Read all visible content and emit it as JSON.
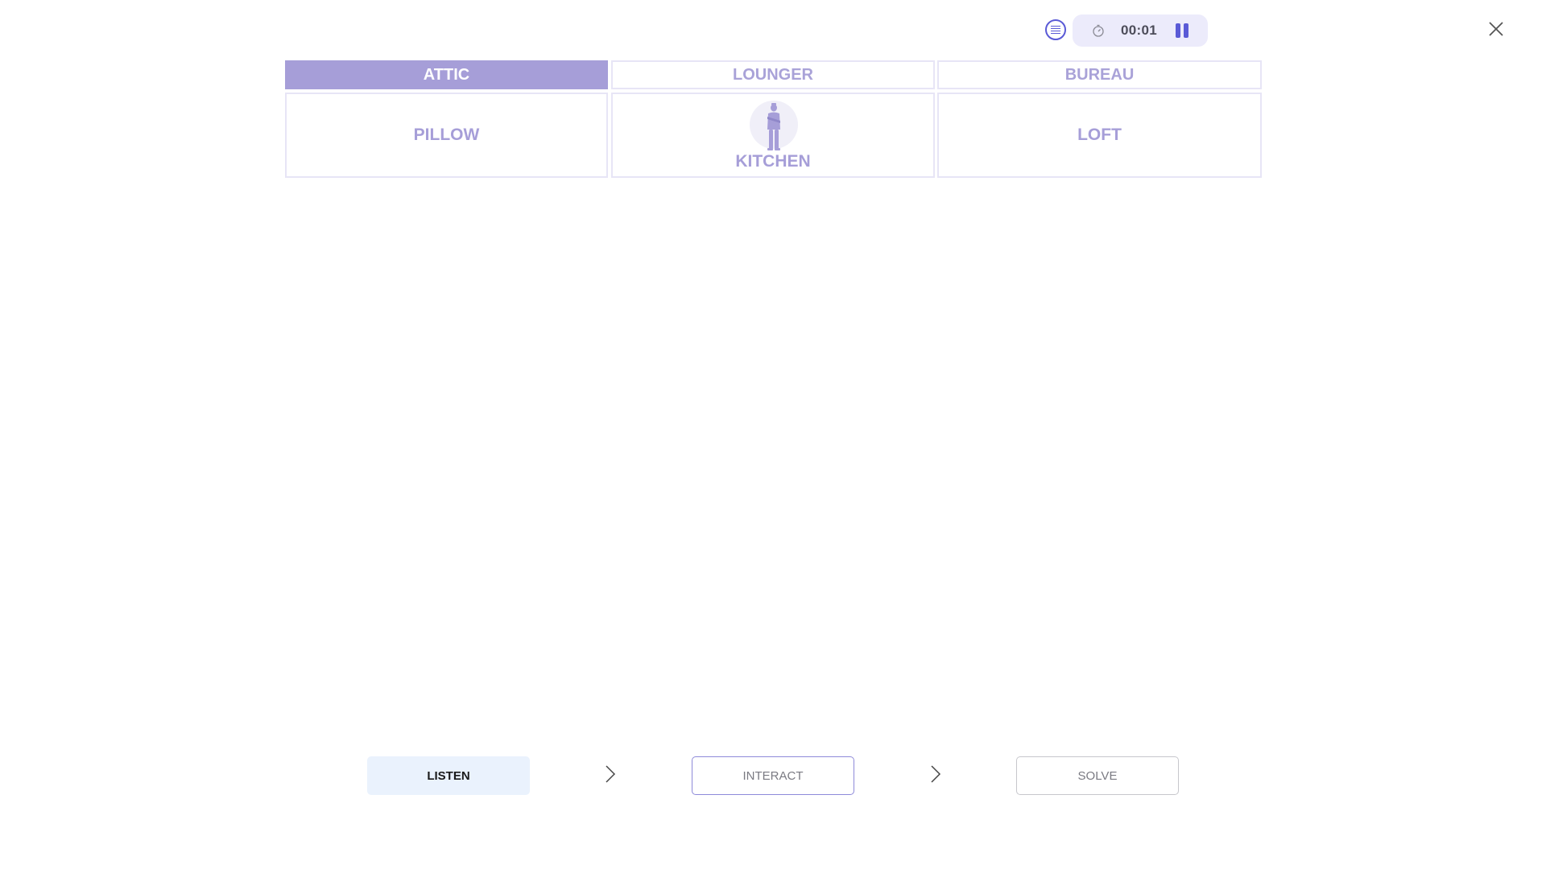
{
  "top_bar": {
    "list_icon": "list-icon",
    "stopwatch_icon": "stopwatch-icon",
    "timer": "00:01",
    "pause_icon": "pause-icon",
    "close_icon": "close-icon"
  },
  "grid": {
    "headers": [
      {
        "label": "ATTIC",
        "active": true
      },
      {
        "label": "LOUNGER",
        "active": false
      },
      {
        "label": "BUREAU",
        "active": false
      }
    ],
    "rooms": [
      {
        "label": "PILLOW",
        "has_person": false
      },
      {
        "label": "KITCHEN",
        "has_person": true,
        "person_icon": "person-silhouette-icon"
      },
      {
        "label": "LOFT",
        "has_person": false
      }
    ]
  },
  "steps": {
    "listen": "LISTEN",
    "interact": "INTERACT",
    "solve": "SOLVE",
    "arrow_icon": "chevron-right-icon"
  },
  "colors": {
    "accent": "#a69ed8",
    "accent_dark": "#5a5ad6",
    "pill_bg": "#ecebfb",
    "listen_bg": "#eaf2fd"
  }
}
